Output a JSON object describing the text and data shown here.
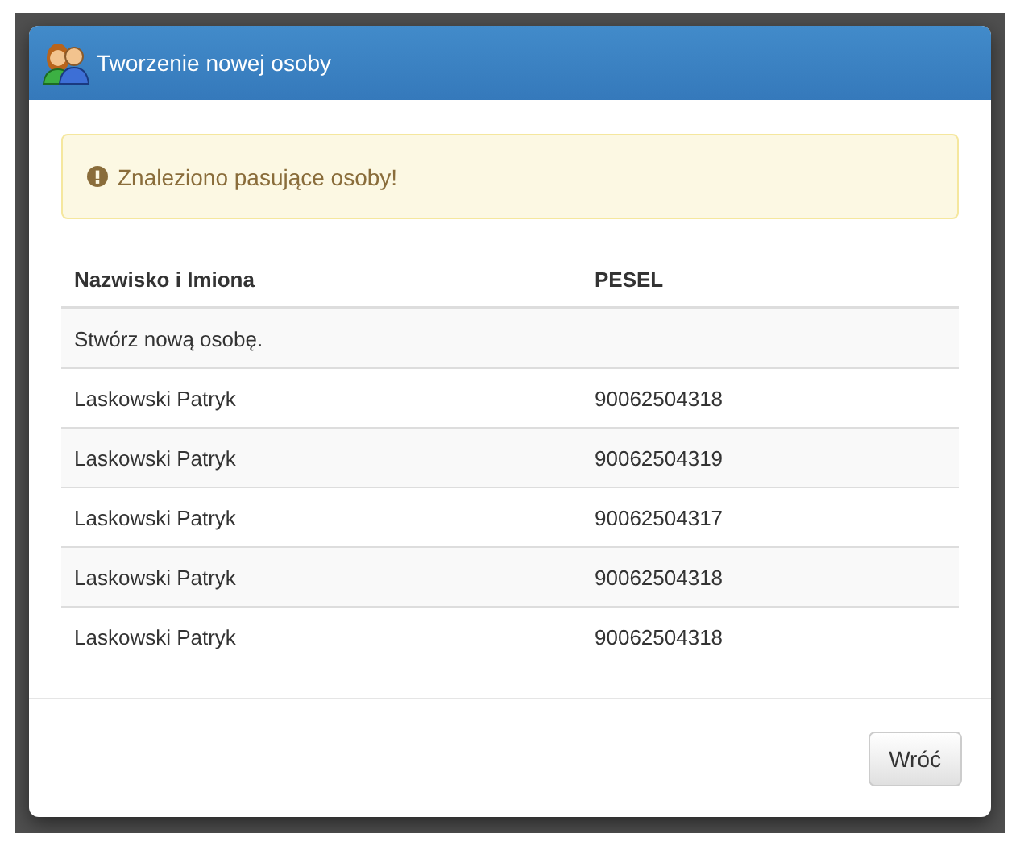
{
  "dialog": {
    "title": "Tworzenie nowej osoby",
    "alert": {
      "kind": "warning",
      "text": "Znaleziono pasujące osoby!"
    },
    "table": {
      "columns": [
        "Nazwisko i Imiona",
        "PESEL"
      ],
      "rows": [
        {
          "name": "Stwórz nową osobę.",
          "pesel": null
        },
        {
          "name": "Laskowski Patryk",
          "pesel": "90062504318"
        },
        {
          "name": "Laskowski Patryk",
          "pesel": "90062504319"
        },
        {
          "name": "Laskowski Patryk",
          "pesel": "90062504317"
        },
        {
          "name": "Laskowski Patryk",
          "pesel": "90062504318"
        },
        {
          "name": "Laskowski Patryk",
          "pesel": "90062504318"
        }
      ]
    },
    "buttons": [
      "Wróć"
    ]
  }
}
